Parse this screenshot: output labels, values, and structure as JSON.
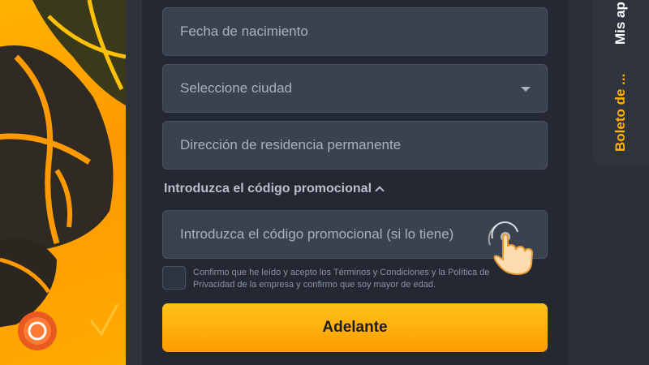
{
  "form": {
    "birthdate_placeholder": "Fecha de nacimiento",
    "city_placeholder": "Seleccione ciudad",
    "address_placeholder": "Dirección de residencia permanente",
    "promo_toggle_label": "Introduzca el código promocional",
    "promo_placeholder": "Introduzca el código promocional (si lo tiene)",
    "consent_text": "Confirmo que he leído y acepto los Términos y Condiciones y la Política de Privacidad de la empresa y confirmo que soy mayor de edad.",
    "submit_label": "Adelante"
  },
  "rail": {
    "tab1": "Mis ap",
    "tab2": "Boleto de ..."
  },
  "colors": {
    "accent": "#ffb300",
    "panel": "#232832",
    "field": "#3a4250"
  },
  "icons": [
    "chevron-down-icon",
    "chevron-up-icon",
    "tap-hand-icon",
    "coin-icon"
  ]
}
